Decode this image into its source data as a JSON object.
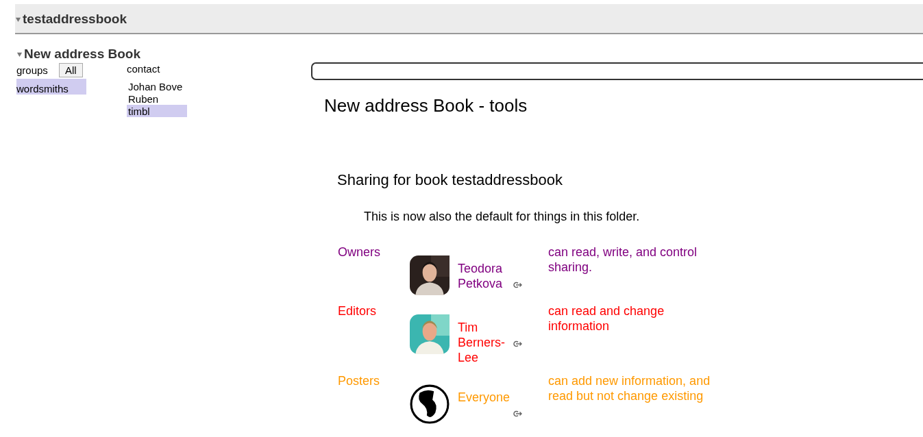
{
  "book": {
    "title": "testaddressbook",
    "expanded": true
  },
  "address_book": {
    "title": "New address Book",
    "expanded": true,
    "groups_label": "groups",
    "all_button": "All",
    "groups": [
      {
        "name": "wordsmiths",
        "selected": true
      }
    ],
    "contacts_label": "contact",
    "contacts": [
      {
        "name": "Johan Bove",
        "selected": false
      },
      {
        "name": "Ruben",
        "selected": false
      },
      {
        "name": "timbl",
        "selected": true
      }
    ]
  },
  "tools": {
    "title": "New address Book - tools",
    "sharing_title": "Sharing for book testaddressbook",
    "note": "This is now also the default for things in this folder.",
    "roles": [
      {
        "label": "Owners",
        "color": "#800080",
        "description": "can read, write, and control sharing.",
        "members": [
          {
            "name": "Teodora Petkova",
            "kind": "person"
          }
        ]
      },
      {
        "label": "Editors",
        "color": "#ff0000",
        "description": "can read and change information",
        "members": [
          {
            "name": "Tim Berners-Lee",
            "kind": "person"
          }
        ]
      },
      {
        "label": "Posters",
        "color": "#ff9900",
        "description": "can add new information, and read but not change existing",
        "members": [
          {
            "name": "Everyone",
            "kind": "globe"
          }
        ]
      }
    ]
  }
}
